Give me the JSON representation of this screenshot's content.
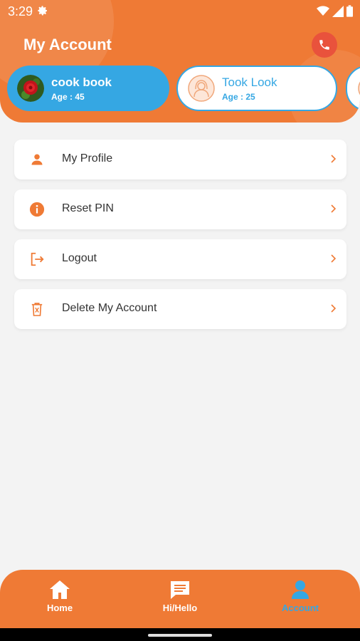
{
  "status_bar": {
    "time": "3:29"
  },
  "header": {
    "title": "My Account"
  },
  "profiles": [
    {
      "name": "cook book",
      "age": "Age : 45"
    },
    {
      "name": "Took Look",
      "age": "Age : 25"
    }
  ],
  "menu": [
    {
      "label": "My Profile",
      "icon": "person-icon"
    },
    {
      "label": "Reset PIN",
      "icon": "info-icon"
    },
    {
      "label": "Logout",
      "icon": "logout-icon"
    },
    {
      "label": "Delete My Account",
      "icon": "trash-icon"
    }
  ],
  "bottom_nav": [
    {
      "label": "Home",
      "icon": "home-icon"
    },
    {
      "label": "Hi/Hello",
      "icon": "chat-icon"
    },
    {
      "label": "Account",
      "icon": "account-icon",
      "active": true
    }
  ],
  "colors": {
    "accent": "#ef7a35",
    "blue": "#35a7e3",
    "red": "#e9523c"
  }
}
